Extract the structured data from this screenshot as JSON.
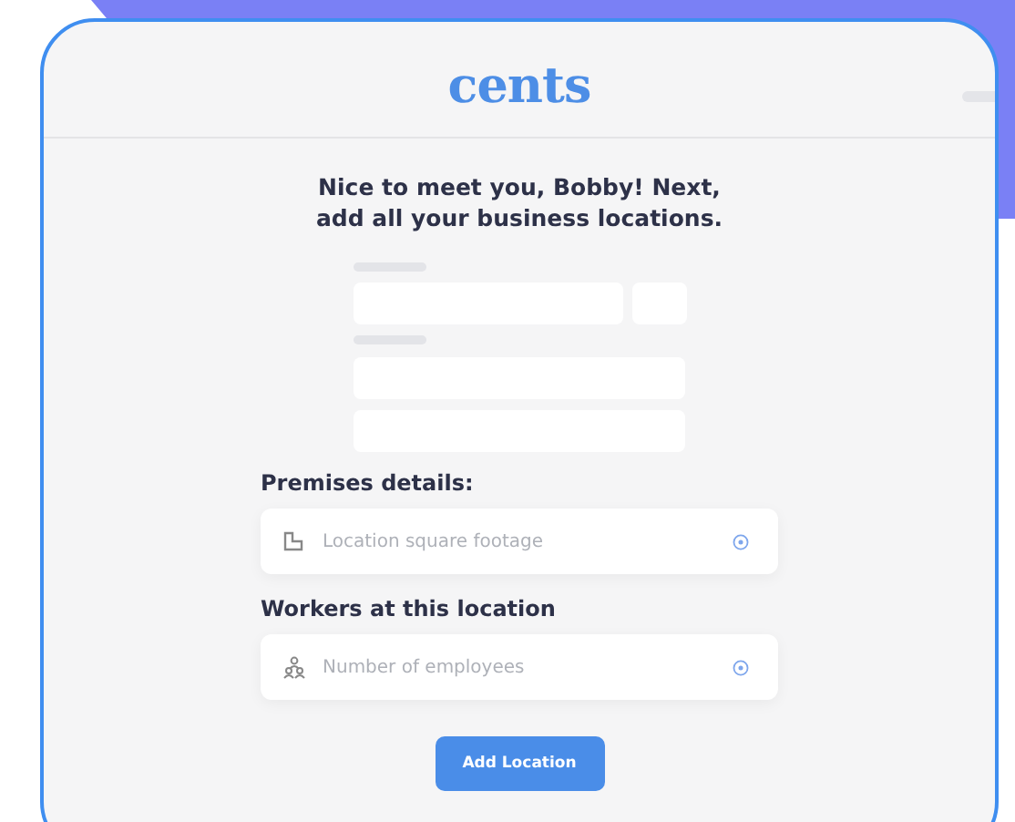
{
  "logo": "cents",
  "heading": "Nice to meet you, Bobby! Next,\nadd all your business locations.",
  "sections": [
    {
      "label": "Premises details:",
      "kind": "area",
      "placeholder": "Location square footage"
    },
    {
      "label": "Workers at this location",
      "kind": "people",
      "placeholder": "Number of employees"
    }
  ],
  "button": "Add Location"
}
